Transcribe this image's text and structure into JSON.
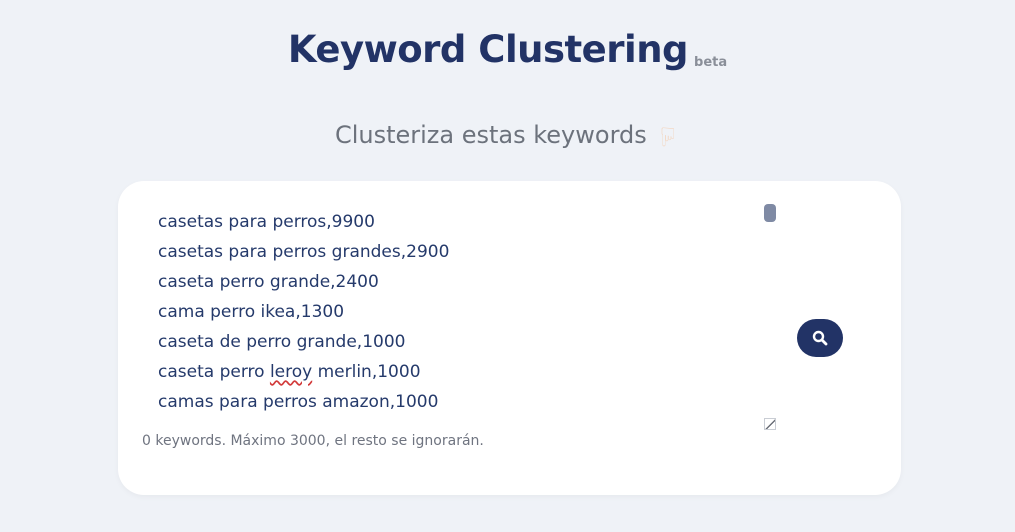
{
  "header": {
    "title": "Keyword Clustering",
    "badge": "beta"
  },
  "subtitle": {
    "text": "Clusteriza estas keywords",
    "icon": "backhand-index-pointing-down"
  },
  "input": {
    "lines": [
      {
        "pre": "casetas para perros,9900",
        "flag": "",
        "post": ""
      },
      {
        "pre": "casetas para perros grandes,2900",
        "flag": "",
        "post": ""
      },
      {
        "pre": "caseta perro grande,2400",
        "flag": "",
        "post": ""
      },
      {
        "pre": "cama perro ikea,1300",
        "flag": "",
        "post": ""
      },
      {
        "pre": "caseta de perro grande,1000",
        "flag": "",
        "post": ""
      },
      {
        "pre": "caseta perro ",
        "flag": "leroy",
        "post": " merlin,1000"
      },
      {
        "pre": "camas para perros amazon,1000",
        "flag": "",
        "post": ""
      }
    ]
  },
  "status": {
    "text": "0 keywords. Máximo 3000, el resto se ignorarán."
  },
  "search_button": {
    "icon": "search-icon"
  },
  "colors": {
    "background": "#eff2f7",
    "card": "#ffffff",
    "accent": "#223366",
    "text": "#253a6b",
    "muted": "#6f7480",
    "spellcheck": "#d23a3a"
  }
}
